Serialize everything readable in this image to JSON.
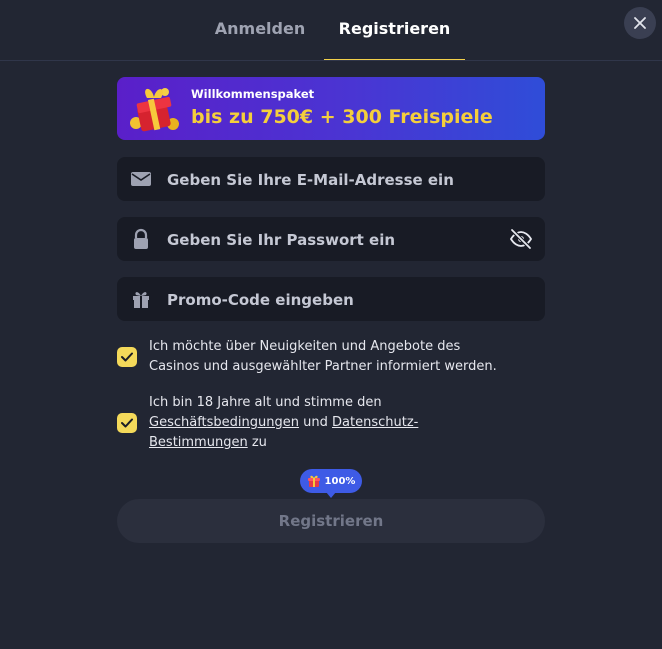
{
  "tabs": {
    "login": "Anmelden",
    "register": "Registrieren"
  },
  "banner": {
    "subtitle": "Willkommenspaket",
    "title": "bis zu 750€ + 300 Freispiele"
  },
  "fields": {
    "email_placeholder": "Geben Sie Ihre E-Mail-Adresse ein",
    "password_placeholder": "Geben Sie Ihr Passwort ein",
    "promo_placeholder": "Promo-Code eingeben"
  },
  "checks": {
    "news_line1": "Ich möchte über Neuigkeiten und Angebote des",
    "news_line2": "Casinos und ausgewählter Partner informiert werden.",
    "news_checked": true,
    "terms_line1": "Ich bin 18 Jahre alt und stimme den",
    "terms_link": "Geschäftsbedingungen",
    "terms_and": "und",
    "privacy_link_part1": "Datenschutz-",
    "privacy_link_part2": "Bestimmungen",
    "terms_end": "zu",
    "terms_checked": true
  },
  "progress": {
    "label": "100%",
    "value": 100
  },
  "submit_label": "Registrieren",
  "icons": {
    "close": "close-icon",
    "email": "envelope-icon",
    "password": "lock-icon",
    "eye": "eye-off-icon",
    "promo": "gift-icon",
    "banner": "gift-box-icon"
  },
  "colors": {
    "background": "#222633",
    "accent": "#f2d04a",
    "banner_from": "#5a1fc9",
    "banner_to": "#2f4dd8",
    "banner_title": "#f4cf3c",
    "badge": "#3e5be6"
  }
}
